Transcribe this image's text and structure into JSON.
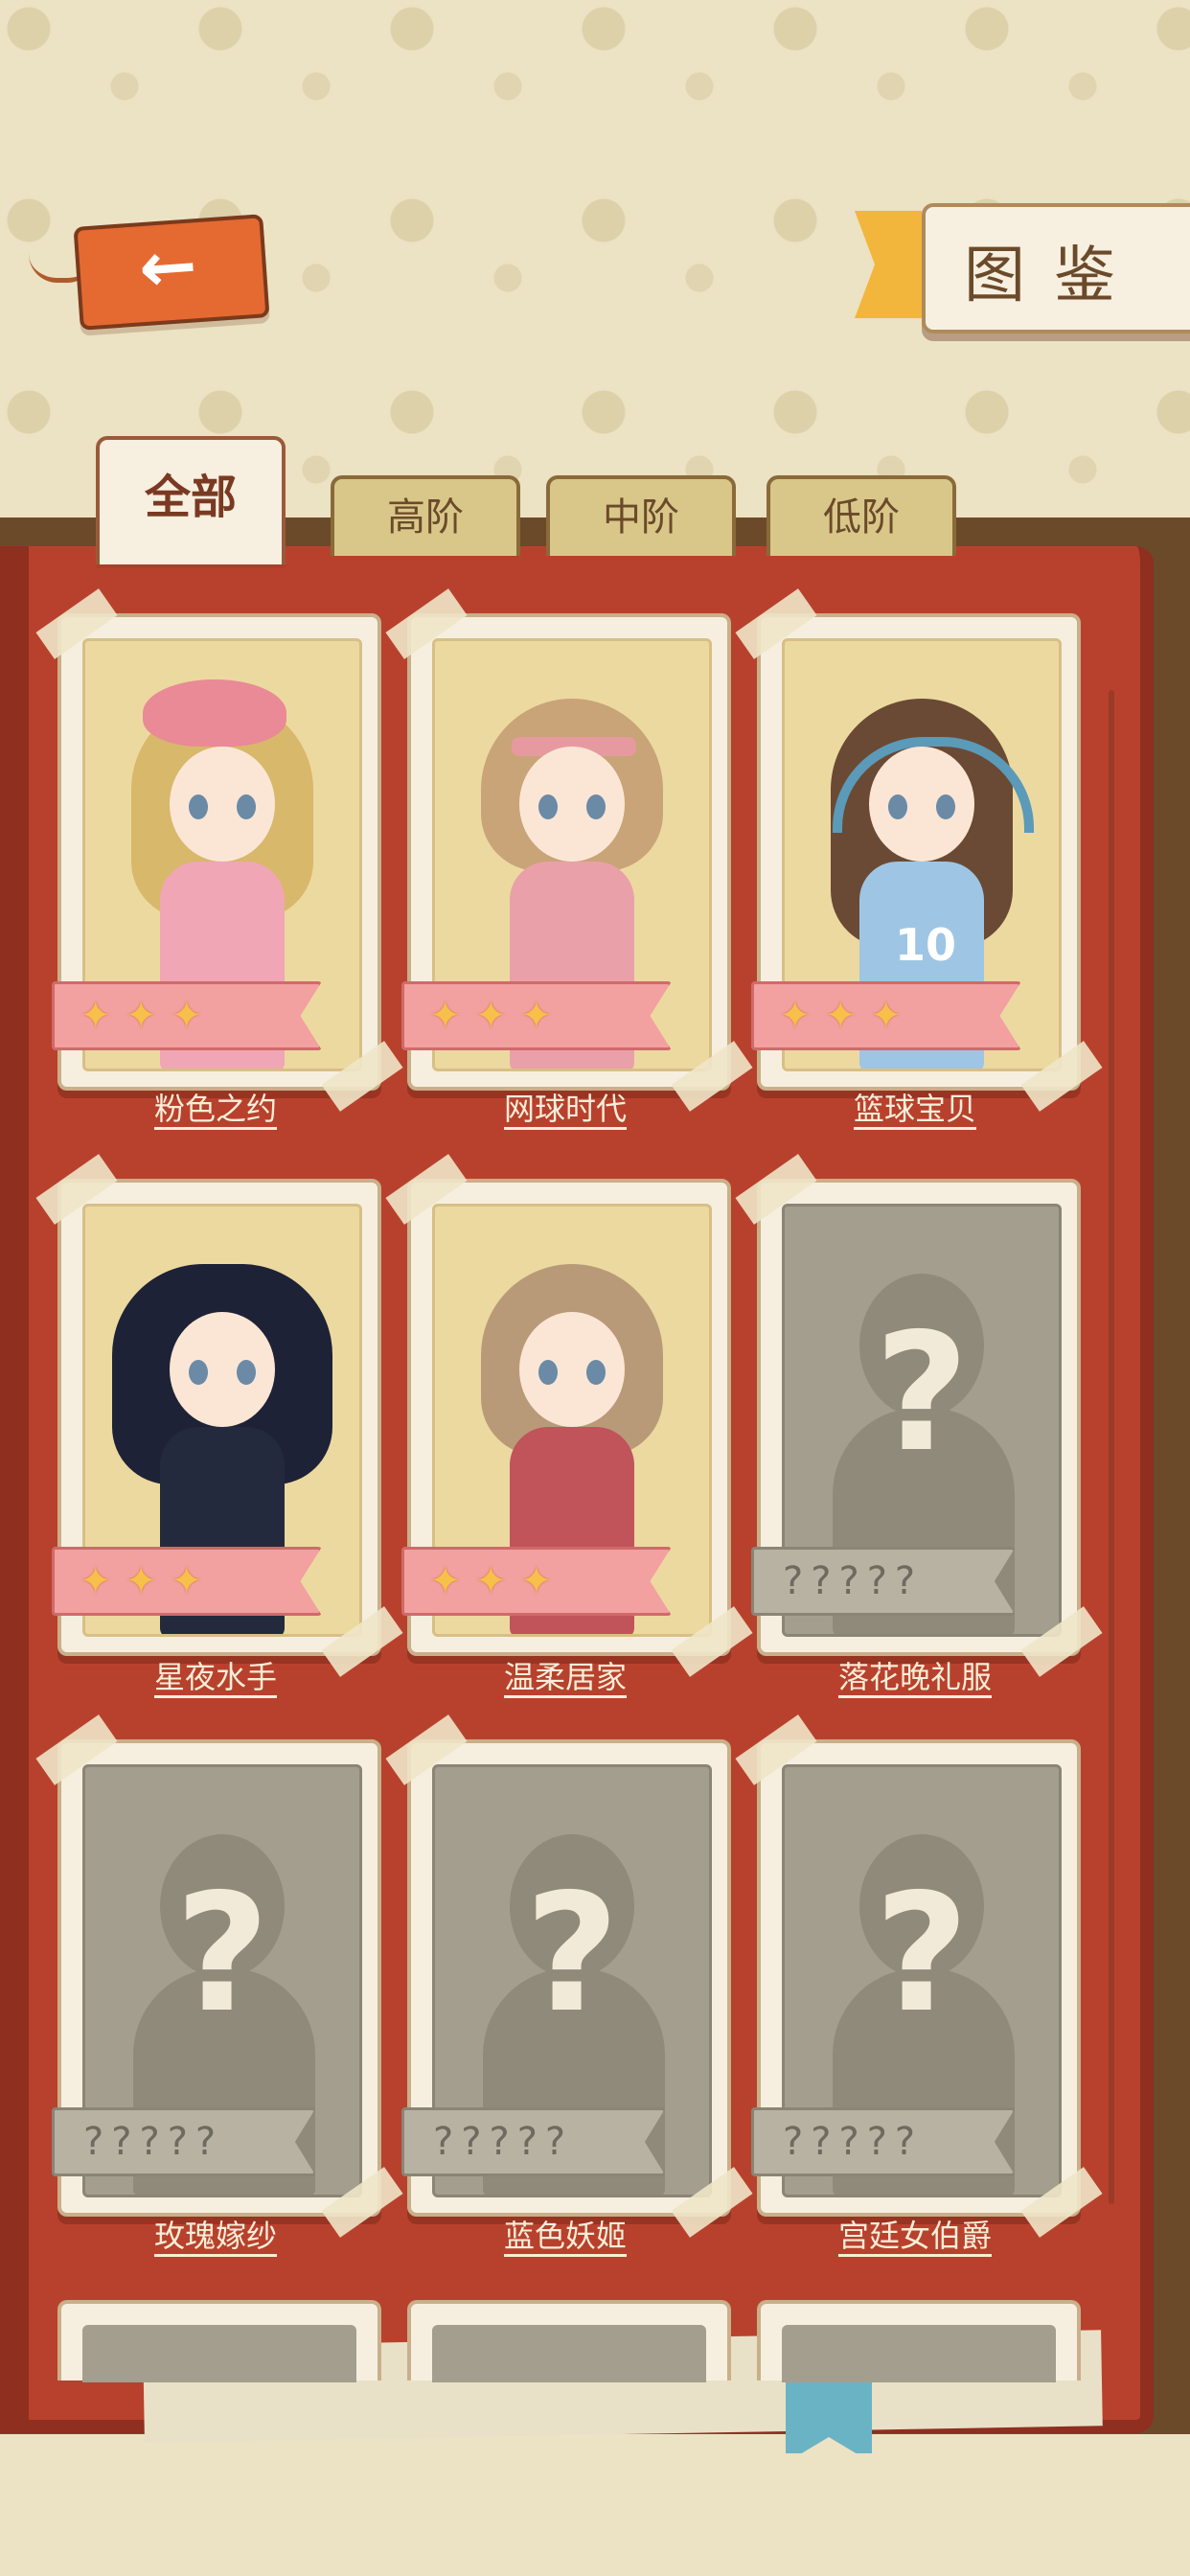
{
  "header": {
    "title": "图鉴",
    "back_icon": "arrow-left-icon"
  },
  "tabs": [
    {
      "label": "全部",
      "active": true
    },
    {
      "label": "高阶",
      "active": false
    },
    {
      "label": "中阶",
      "active": false
    },
    {
      "label": "低阶",
      "active": false
    }
  ],
  "cards": [
    {
      "name": "粉色之约",
      "unlocked": true,
      "stars": 3
    },
    {
      "name": "网球时代",
      "unlocked": true,
      "stars": 3
    },
    {
      "name": "篮球宝贝",
      "unlocked": true,
      "stars": 3,
      "jersey": "10"
    },
    {
      "name": "星夜水手",
      "unlocked": true,
      "stars": 3
    },
    {
      "name": "温柔居家",
      "unlocked": true,
      "stars": 3
    },
    {
      "name": "落花晚礼服",
      "unlocked": false,
      "placeholder": "?????"
    },
    {
      "name": "玫瑰嫁纱",
      "unlocked": false,
      "placeholder": "?????"
    },
    {
      "name": "蓝色妖姬",
      "unlocked": false,
      "placeholder": "?????"
    },
    {
      "name": "宫廷女伯爵",
      "unlocked": false,
      "placeholder": "?????"
    }
  ],
  "colors": {
    "book": "#b8412d",
    "background": "#ece2c4",
    "tab_active": "#f7efe0",
    "back_tag": "#e46a32",
    "star": "#f7c04a"
  }
}
